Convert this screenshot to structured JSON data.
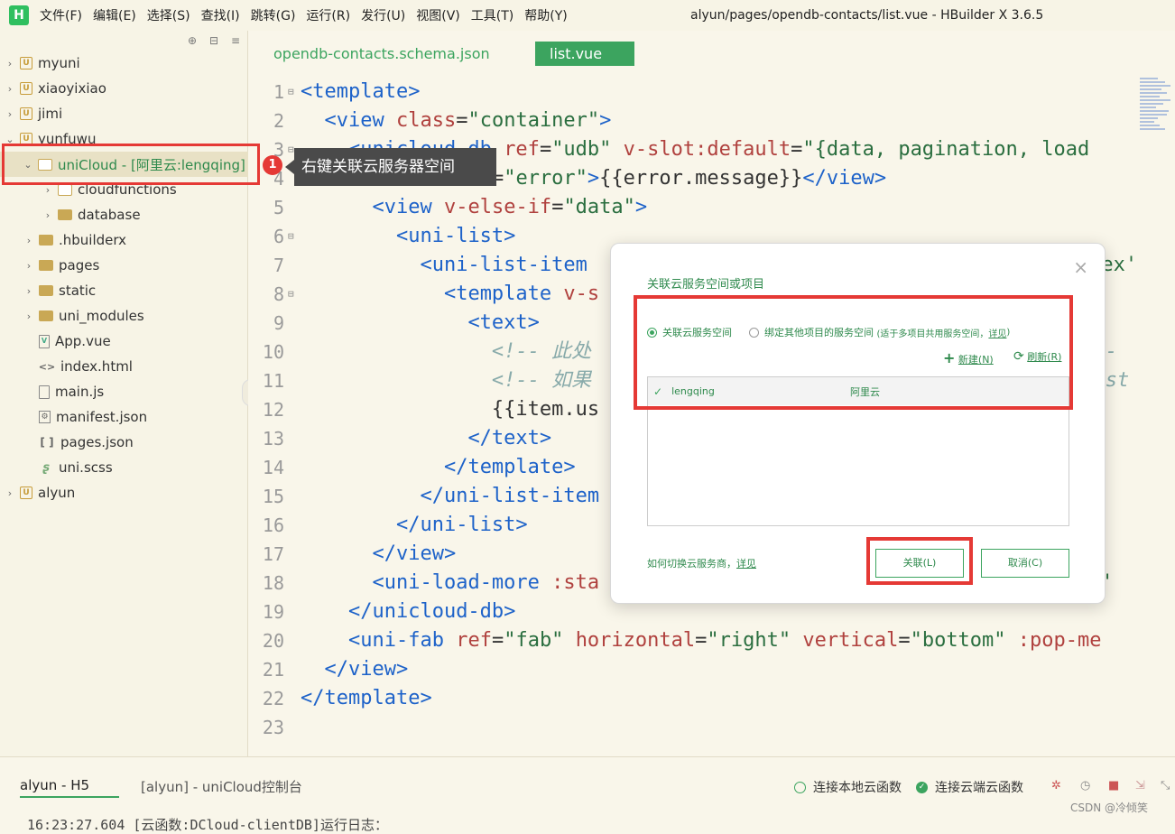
{
  "app": {
    "logo": "H",
    "menus": [
      "文件(F)",
      "编辑(E)",
      "选择(S)",
      "查找(I)",
      "跳转(G)",
      "运行(R)",
      "发行(U)",
      "视图(V)",
      "工具(T)",
      "帮助(Y)"
    ],
    "window_title": "alyun/pages/opendb-contacts/list.vue - HBuilder X 3.6.5"
  },
  "sidebar": {
    "items": [
      {
        "label": "myuni"
      },
      {
        "label": "xiaoyixiao"
      },
      {
        "label": "jimi"
      },
      {
        "label": "yunfuwu"
      },
      {
        "label": "uniCloud - [阿里云:lengqing]"
      },
      {
        "label": "cloudfunctions"
      },
      {
        "label": "database"
      },
      {
        "label": ".hbuilderx"
      },
      {
        "label": "pages"
      },
      {
        "label": "static"
      },
      {
        "label": "uni_modules"
      },
      {
        "label": "App.vue"
      },
      {
        "label": "index.html"
      },
      {
        "label": "main.js"
      },
      {
        "label": "manifest.json"
      },
      {
        "label": "pages.json"
      },
      {
        "label": "uni.scss"
      },
      {
        "label": "alyun"
      }
    ]
  },
  "tooltip": {
    "step": "1",
    "text": "右键关联云服务器空间"
  },
  "tabs": [
    "opendb-contacts.schema.json",
    "list.vue"
  ],
  "line_numbers": [
    "1",
    "2",
    "3",
    "4",
    "5",
    "6",
    "7",
    "8",
    "9",
    "10",
    "11",
    "12",
    "13",
    "14",
    "15",
    "16",
    "17",
    "18",
    "19",
    "20",
    "21",
    "22",
    "23"
  ],
  "dialog": {
    "title": "关联云服务空间或项目",
    "close": "×",
    "radio1": "关联云服务空间",
    "radio2": "绑定其他项目的服务空间",
    "radio2_note": "(适于多项目共用服务空间，",
    "radio2_link": "详见",
    "radio2_end": ")",
    "new_btn": "新建(N)",
    "refresh_btn": "刷新(R)",
    "row_name": "lengqing",
    "row_vendor": "阿里云",
    "help_text": "如何切换云服务商，",
    "help_link": "详见",
    "ok_btn": "关联(L)",
    "cancel_btn": "取消(C)"
  },
  "bottom": {
    "tab1": "alyun - H5",
    "tab2": "[alyun] - uniCloud控制台",
    "status_local": "连接本地云函数",
    "status_cloud": "连接云端云函数",
    "log": "16:23:27.604 [云函数:DCloud-clientDB]运行日志：",
    "watermark": "CSDN @冷倾笑"
  },
  "colors": {
    "accent": "#3ca45f",
    "highlight": "#e53935"
  }
}
